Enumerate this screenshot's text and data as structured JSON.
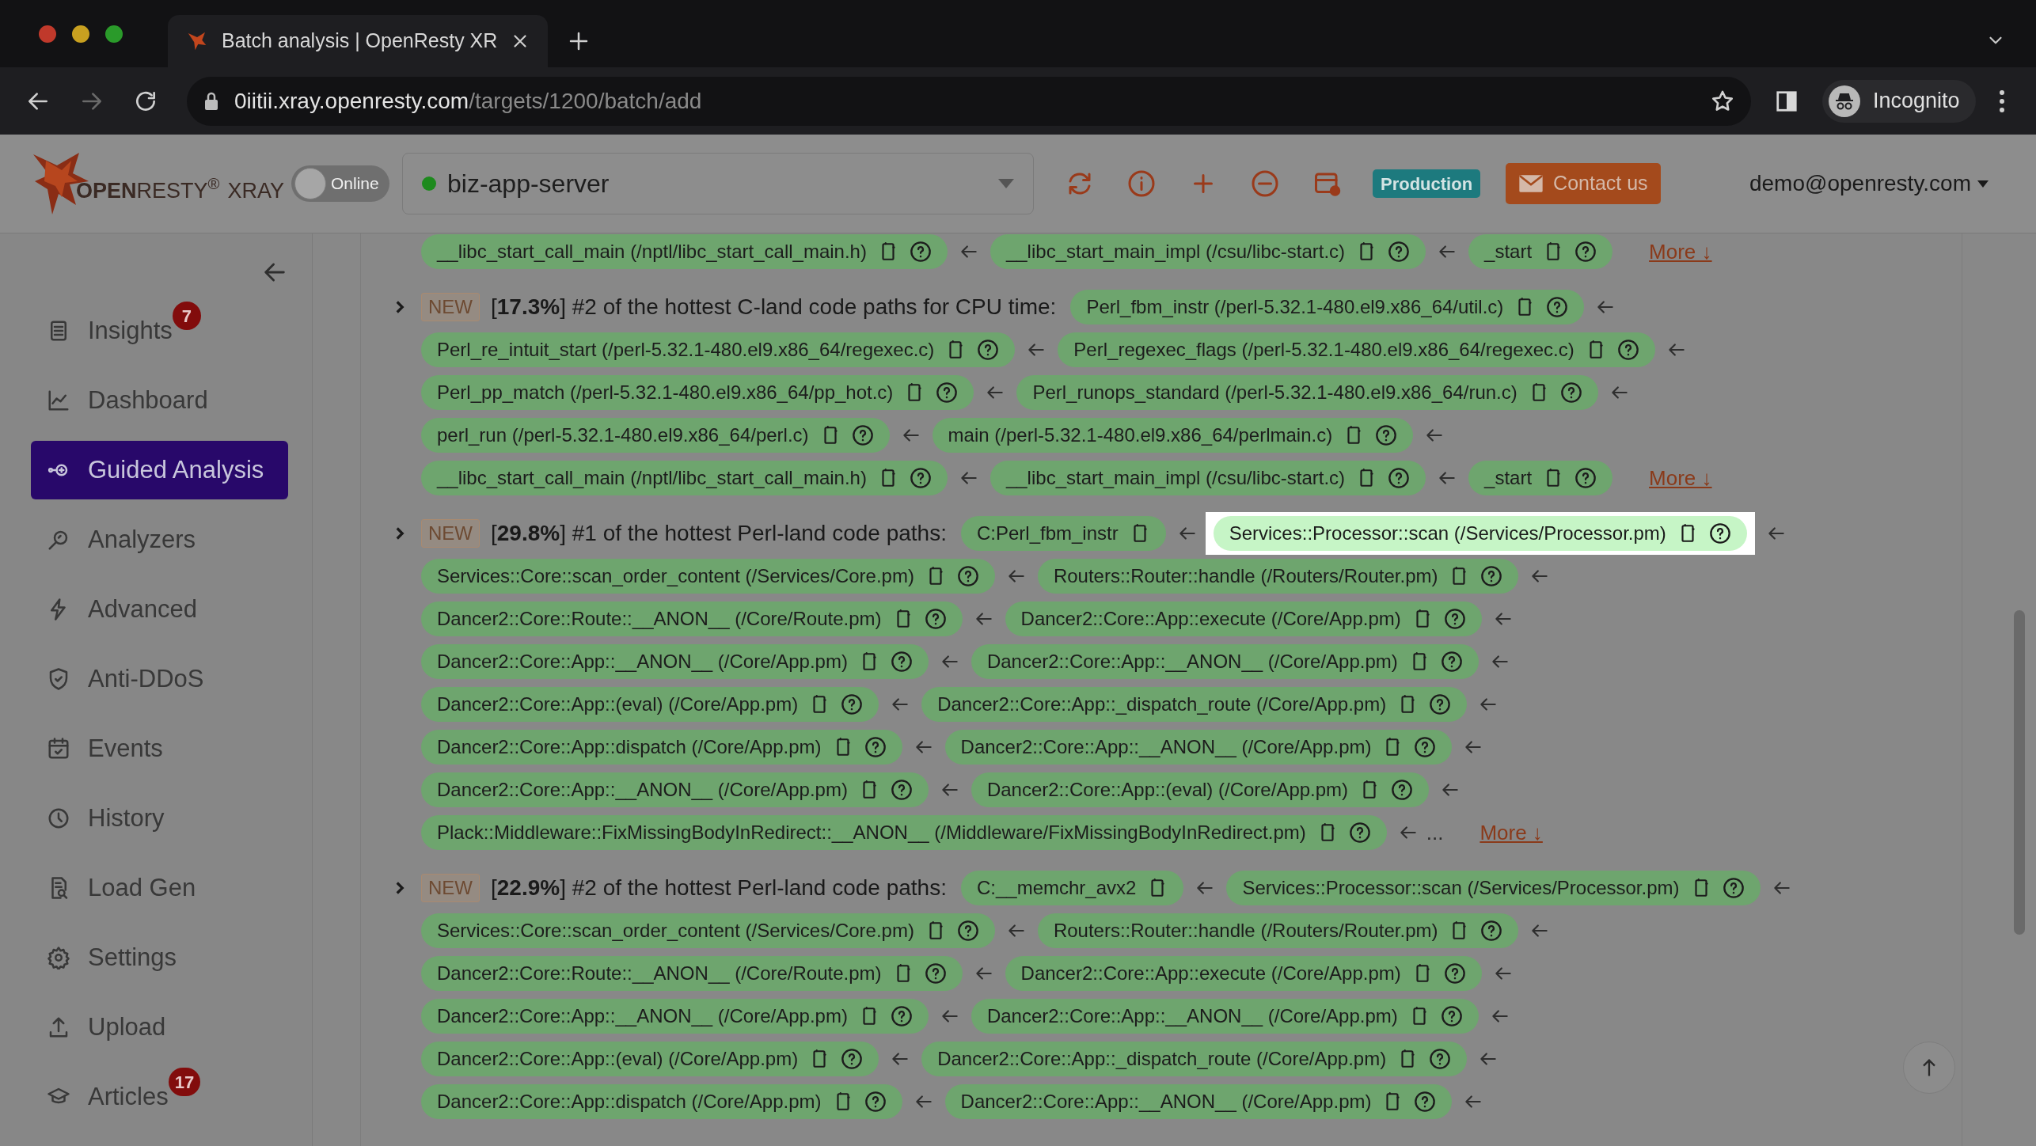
{
  "browser": {
    "tab_title": "Batch analysis | OpenResty XR",
    "url_host": "0iitii.xray.openresty.com",
    "url_path": "/targets/1200/batch/add",
    "profile": "Incognito"
  },
  "header": {
    "logo_brand": "**OPEN**RESTY$^{®}$",
    "logo_product": "XRAY",
    "status_toggle": {
      "label": "Online",
      "on": false
    },
    "server": {
      "name": "biz-app-server",
      "color": "#1e8a1e"
    },
    "environment": "Production",
    "contact": "Contact us",
    "user": "demo@openresty.com"
  },
  "sidebar": {
    "items": [
      {
        "label": "Insights",
        "badge": "7",
        "selected": false
      },
      {
        "label": "Dashboard",
        "selected": false
      },
      {
        "label": "Guided Analysis",
        "selected": true
      },
      {
        "label": "Analyzers",
        "selected": false
      },
      {
        "label": "Advanced",
        "selected": false
      },
      {
        "label": "Anti-DDoS",
        "selected": false
      },
      {
        "label": "Events",
        "selected": false
      },
      {
        "label": "History",
        "selected": false
      },
      {
        "label": "Load Gen",
        "selected": false
      },
      {
        "label": "Settings",
        "selected": false
      },
      {
        "label": "Upload",
        "selected": false
      },
      {
        "label": "Articles",
        "badge": "17",
        "selected": false
      }
    ]
  },
  "sections": [
    {
      "lines": [
        {
          "chips": [
            {
              "text": "__libc_start_call_main (/nptl/libc_start_call_main.h)",
              "kind": "frame",
              "arrow": true,
              "highlighted": false
            },
            {
              "text": "__libc_start_main_impl (/csu/libc-start.c)",
              "kind": "frame",
              "arrow": true,
              "highlighted": false
            },
            {
              "text": "_start",
              "kind": "frame",
              "arrow": false,
              "highlighted": false
            }
          ],
          "more": "More ↓"
        }
      ]
    },
    {
      "expanded": false,
      "badge": "NEW",
      "title": "[**17.3%**] #2 of the hottest C-land code paths for CPU time:",
      "lead": [
        {
          "text": "Perl_fbm_instr (/perl-5.32.1-480.el9.x86_64/util.c)",
          "kind": "frame",
          "arrow": true,
          "highlighted": false
        }
      ],
      "lines": [
        {
          "chips": [
            {
              "text": "Perl_re_intuit_start (/perl-5.32.1-480.el9.x86_64/regexec.c)",
              "kind": "frame",
              "arrow": true,
              "highlighted": false
            },
            {
              "text": "Perl_regexec_flags (/perl-5.32.1-480.el9.x86_64/regexec.c)",
              "kind": "frame",
              "arrow": true,
              "highlighted": false
            }
          ]
        },
        {
          "chips": [
            {
              "text": "Perl_pp_match (/perl-5.32.1-480.el9.x86_64/pp_hot.c)",
              "kind": "frame",
              "arrow": true,
              "highlighted": false
            },
            {
              "text": "Perl_runops_standard (/perl-5.32.1-480.el9.x86_64/run.c)",
              "kind": "frame",
              "arrow": true,
              "highlighted": false
            }
          ]
        },
        {
          "chips": [
            {
              "text": "perl_run (/perl-5.32.1-480.el9.x86_64/perl.c)",
              "kind": "frame",
              "arrow": true,
              "highlighted": false
            },
            {
              "text": "main (/perl-5.32.1-480.el9.x86_64/perlmain.c)",
              "kind": "frame",
              "arrow": true,
              "highlighted": false
            }
          ]
        },
        {
          "chips": [
            {
              "text": "__libc_start_call_main (/nptl/libc_start_call_main.h)",
              "kind": "frame",
              "arrow": true,
              "highlighted": false
            },
            {
              "text": "__libc_start_main_impl (/csu/libc-start.c)",
              "kind": "frame",
              "arrow": true,
              "highlighted": false
            },
            {
              "text": "_start",
              "kind": "frame",
              "arrow": false,
              "highlighted": false
            }
          ],
          "more": "More ↓"
        }
      ]
    },
    {
      "expanded": false,
      "badge": "NEW",
      "title": "[**29.8%**] #1 of the hottest Perl-land code paths:",
      "lead": [
        {
          "text": "C:Perl_fbm_instr",
          "kind": "c_frame",
          "arrow": true,
          "highlighted": false
        },
        {
          "text": "Services::Processor::scan (/Services/Processor.pm)",
          "kind": "frame",
          "arrow": true,
          "highlighted": true
        }
      ],
      "lines": [
        {
          "chips": [
            {
              "text": "Services::Core::scan_order_content (/Services/Core.pm)",
              "kind": "frame",
              "arrow": true,
              "highlighted": false
            },
            {
              "text": "Routers::Router::handle (/Routers/Router.pm)",
              "kind": "frame",
              "arrow": true,
              "highlighted": false
            }
          ]
        },
        {
          "chips": [
            {
              "text": "Dancer2::Core::Route::__ANON__ (/Core/Route.pm)",
              "kind": "frame",
              "arrow": true,
              "highlighted": false
            },
            {
              "text": "Dancer2::Core::App::execute (/Core/App.pm)",
              "kind": "frame",
              "arrow": true,
              "highlighted": false
            }
          ]
        },
        {
          "chips": [
            {
              "text": "Dancer2::Core::App::__ANON__ (/Core/App.pm)",
              "kind": "frame",
              "arrow": true,
              "highlighted": false
            },
            {
              "text": "Dancer2::Core::App::__ANON__ (/Core/App.pm)",
              "kind": "frame",
              "arrow": true,
              "highlighted": false
            }
          ]
        },
        {
          "chips": [
            {
              "text": "Dancer2::Core::App::(eval) (/Core/App.pm)",
              "kind": "frame",
              "arrow": true,
              "highlighted": false
            },
            {
              "text": "Dancer2::Core::App::_dispatch_route (/Core/App.pm)",
              "kind": "frame",
              "arrow": true,
              "highlighted": false
            }
          ]
        },
        {
          "chips": [
            {
              "text": "Dancer2::Core::App::dispatch (/Core/App.pm)",
              "kind": "frame",
              "arrow": true,
              "highlighted": false
            },
            {
              "text": "Dancer2::Core::App::__ANON__ (/Core/App.pm)",
              "kind": "frame",
              "arrow": true,
              "highlighted": false
            }
          ]
        },
        {
          "chips": [
            {
              "text": "Dancer2::Core::App::__ANON__ (/Core/App.pm)",
              "kind": "frame",
              "arrow": true,
              "highlighted": false
            },
            {
              "text": "Dancer2::Core::App::(eval) (/Core/App.pm)",
              "kind": "frame",
              "arrow": true,
              "highlighted": false
            }
          ]
        },
        {
          "chips": [
            {
              "text": "Plack::Middleware::FixMissingBodyInRedirect::__ANON__ (/Middleware/FixMissingBodyInRedirect.pm)",
              "kind": "frame",
              "arrow": true,
              "highlighted": false
            }
          ],
          "ellipsis": "...",
          "more": "More ↓"
        }
      ]
    },
    {
      "expanded": false,
      "badge": "NEW",
      "title": "[**22.9%**] #2 of the hottest Perl-land code paths:",
      "lead": [
        {
          "text": "C:__memchr_avx2",
          "kind": "c_frame",
          "arrow": true,
          "highlighted": false
        },
        {
          "text": "Services::Processor::scan (/Services/Processor.pm)",
          "kind": "frame",
          "arrow": true,
          "highlighted": false
        }
      ],
      "lines": [
        {
          "chips": [
            {
              "text": "Services::Core::scan_order_content (/Services/Core.pm)",
              "kind": "frame",
              "arrow": true,
              "highlighted": false
            },
            {
              "text": "Routers::Router::handle (/Routers/Router.pm)",
              "kind": "frame",
              "arrow": true,
              "highlighted": false
            }
          ]
        },
        {
          "chips": [
            {
              "text": "Dancer2::Core::Route::__ANON__ (/Core/Route.pm)",
              "kind": "frame",
              "arrow": true,
              "highlighted": false
            },
            {
              "text": "Dancer2::Core::App::execute (/Core/App.pm)",
              "kind": "frame",
              "arrow": true,
              "highlighted": false
            }
          ]
        },
        {
          "chips": [
            {
              "text": "Dancer2::Core::App::__ANON__ (/Core/App.pm)",
              "kind": "frame",
              "arrow": true,
              "highlighted": false
            },
            {
              "text": "Dancer2::Core::App::__ANON__ (/Core/App.pm)",
              "kind": "frame",
              "arrow": true,
              "highlighted": false
            }
          ]
        },
        {
          "chips": [
            {
              "text": "Dancer2::Core::App::(eval) (/Core/App.pm)",
              "kind": "frame",
              "arrow": true,
              "highlighted": false
            },
            {
              "text": "Dancer2::Core::App::_dispatch_route (/Core/App.pm)",
              "kind": "frame",
              "arrow": true,
              "highlighted": false
            }
          ]
        },
        {
          "chips": [
            {
              "text": "Dancer2::Core::App::dispatch (/Core/App.pm)",
              "kind": "frame",
              "arrow": true,
              "highlighted": false
            },
            {
              "text": "Dancer2::Core::App::__ANON__ (/Core/App.pm)",
              "kind": "frame",
              "arrow": true,
              "highlighted": false
            }
          ]
        }
      ]
    }
  ]
}
